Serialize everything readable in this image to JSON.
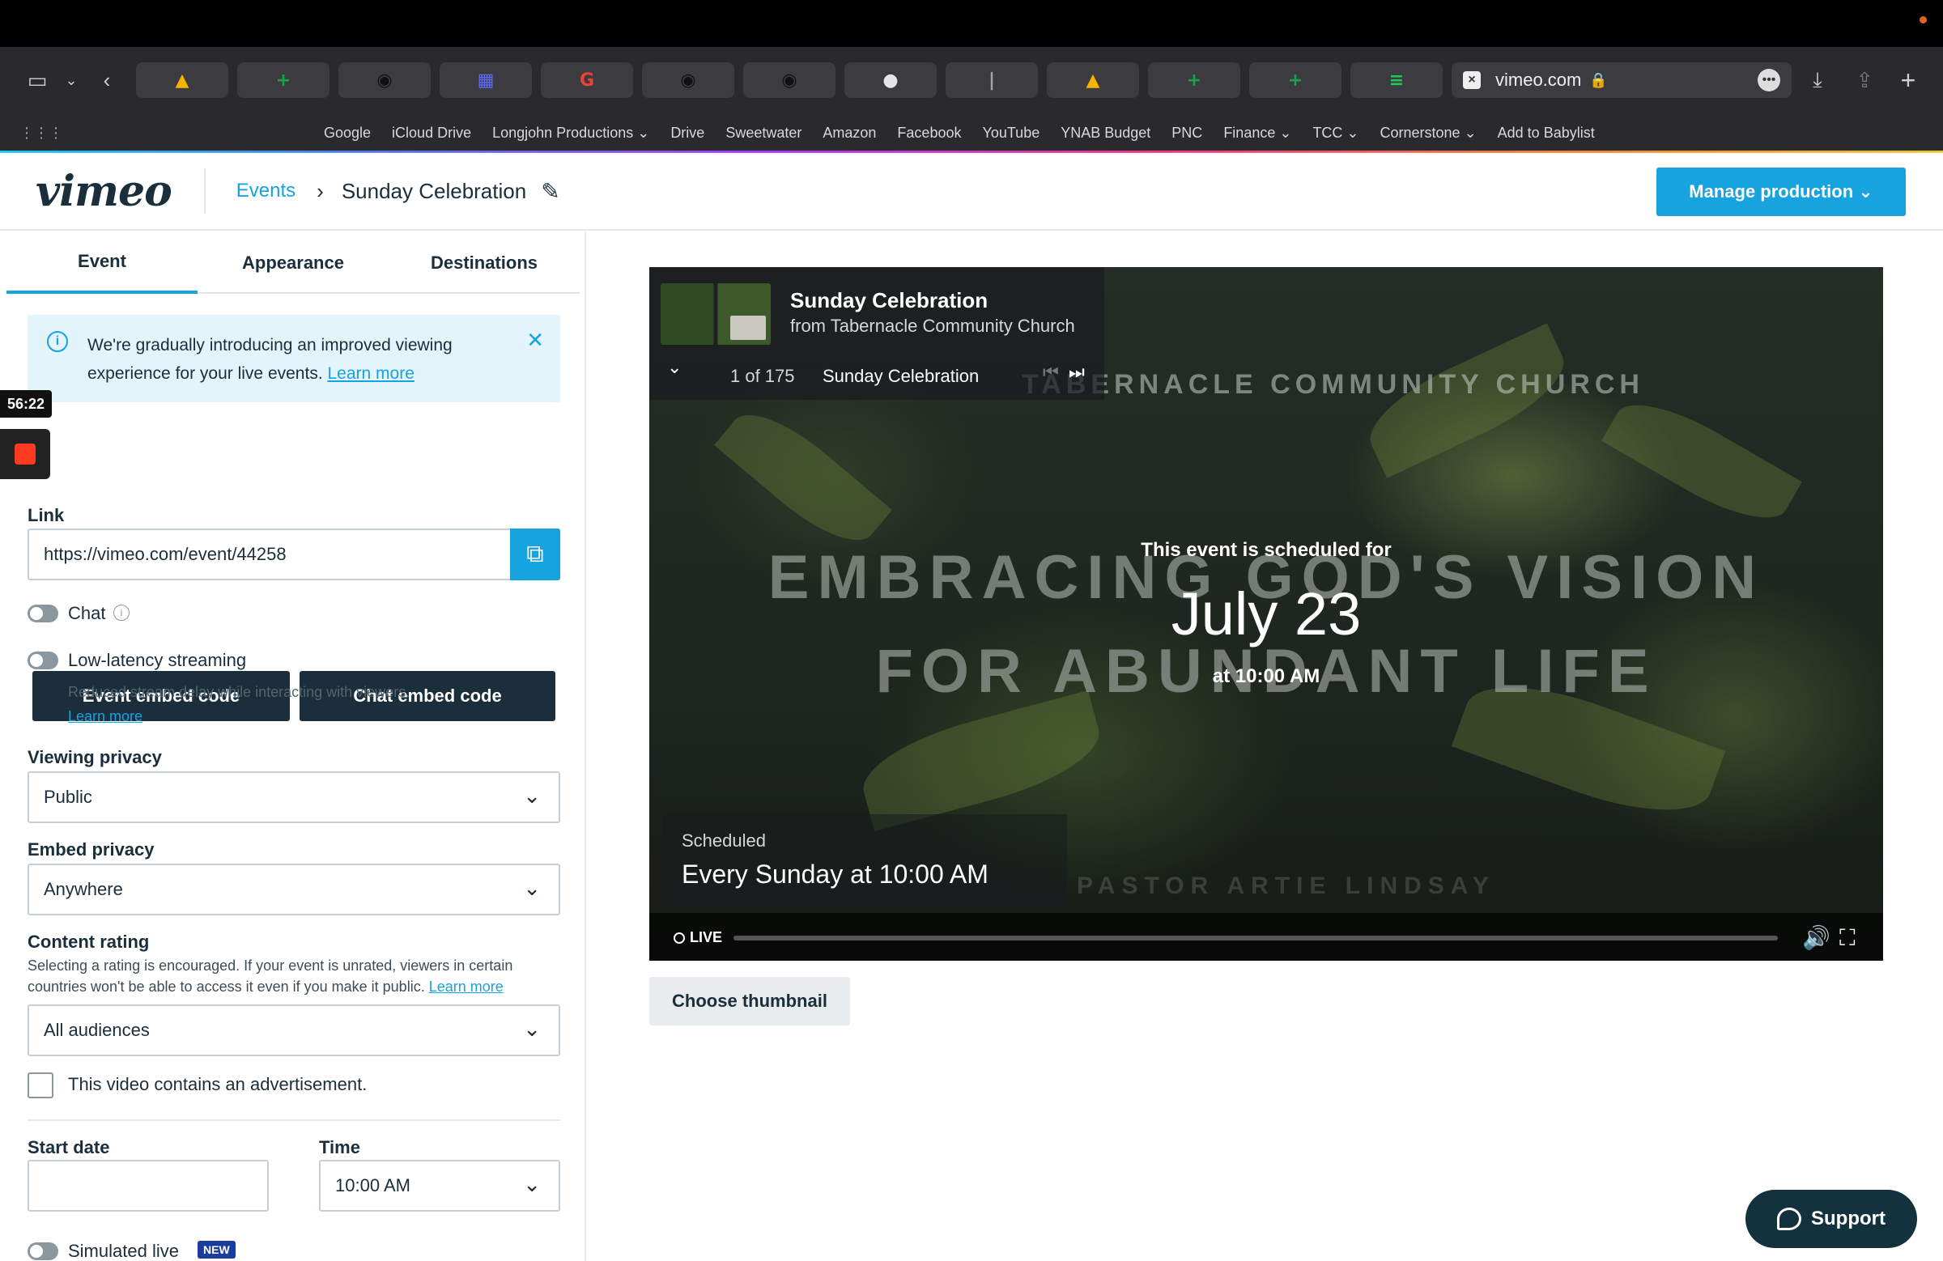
{
  "browser": {
    "url": "vimeo.com",
    "tabs": [
      {
        "icon": "google-drive-icon",
        "color": "#f4b400",
        "glyph": "▲"
      },
      {
        "icon": "google-sheets-plus-icon",
        "color": "#16a34a",
        "glyph": "+"
      },
      {
        "icon": "wifi-router-icon",
        "color": "#111111",
        "glyph": "◉"
      },
      {
        "icon": "calendar-icon",
        "color": "#5b6cff",
        "glyph": "▦"
      },
      {
        "icon": "google-icon",
        "color": "#ea4335",
        "glyph": "G"
      },
      {
        "icon": "wifi-router-icon",
        "color": "#111111",
        "glyph": "◉"
      },
      {
        "icon": "wifi-router-icon",
        "color": "#111111",
        "glyph": "◉"
      },
      {
        "icon": "circle-app-icon",
        "color": "#e5e5e5",
        "glyph": "●"
      },
      {
        "icon": "podcast-icon",
        "color": "#a3a3a3",
        "glyph": "|"
      },
      {
        "icon": "google-drive-icon",
        "color": "#f4b400",
        "glyph": "▲"
      },
      {
        "icon": "google-sheets-plus-icon",
        "color": "#16a34a",
        "glyph": "+"
      },
      {
        "icon": "google-sheets-plus-icon",
        "color": "#16a34a",
        "glyph": "+"
      },
      {
        "icon": "google-sheets-icon",
        "color": "#22c55e",
        "glyph": "≡"
      }
    ],
    "bookmarks": [
      "Google",
      "iCloud Drive",
      "Longjohn Productions ⌄",
      "Drive",
      "Sweetwater",
      "Amazon",
      "Facebook",
      "YouTube",
      "YNAB Budget",
      "PNC",
      "Finance ⌄",
      "TCC ⌄",
      "Cornerstone ⌄",
      "Add to Babylist"
    ]
  },
  "header": {
    "logo": "vimeo",
    "breadcrumb_link": "Events",
    "breadcrumb_sep": "›",
    "title": "Sunday Celebration",
    "manage_label": "Manage production ⌄"
  },
  "panel": {
    "tabs": [
      "Event",
      "Appearance",
      "Destinations"
    ],
    "notice_text": "We're gradually introducing an improved viewing experience for your live events. ",
    "notice_link": "Learn more",
    "recording_time": "56:22",
    "event_embed_label": "Event embed code",
    "chat_embed_label": "Chat embed code",
    "link_label": "Link",
    "link_value": "https://vimeo.com/event/44258",
    "chat_label": "Chat",
    "low_latency_label": "Low-latency streaming",
    "low_latency_hint": "Reduced stream delay while interacting with viewers.",
    "low_latency_link": "Learn more",
    "viewing_privacy_label": "Viewing privacy",
    "viewing_privacy_value": "Public",
    "embed_privacy_label": "Embed privacy",
    "embed_privacy_value": "Anywhere",
    "content_rating_label": "Content rating",
    "content_rating_hint": "Selecting a rating is encouraged. If your event is unrated, viewers in certain countries won't be able to access it even if you make it public. ",
    "content_rating_link": "Learn more",
    "content_rating_value": "All audiences",
    "ad_label": "This video contains an advertisement.",
    "start_date_label": "Start date",
    "start_date_value": "",
    "time_label": "Time",
    "time_value": "10:00 AM",
    "simulated_label": "Simulated live",
    "new_badge": "NEW"
  },
  "player": {
    "church_text": "TABERNACLE COMMUNITY CHURCH",
    "line1": "EMBRACING GOD'S VISION",
    "line2": "FOR ABUNDANT LIFE",
    "pastor": "PASTOR ARTIE LINDSAY",
    "schedule_heading": "This event is scheduled for",
    "schedule_date": "July 23",
    "schedule_time": "at 10:00 AM",
    "overlay_title": "Sunday Celebration",
    "overlay_subtitle": "from Tabernacle Community Church",
    "overlay_count": "1 of 175",
    "overlay_name": "Sunday Celebration",
    "scheduled_label": "Scheduled",
    "scheduled_value": "Every Sunday at 10:00 AM",
    "live_label": "LIVE"
  },
  "choose_thumbnail_label": "Choose thumbnail",
  "support_label": "Support",
  "colors": {
    "accent": "#17a2e0",
    "navy": "#1a2e3b",
    "support_bg": "#14313e"
  }
}
